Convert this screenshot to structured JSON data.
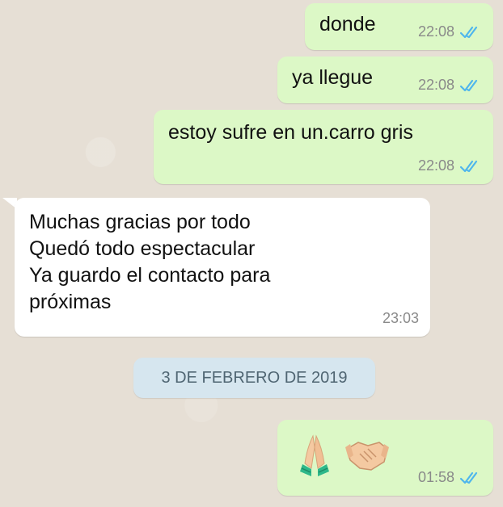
{
  "messages": [
    {
      "text": "donde",
      "time": "22:08",
      "read": true
    },
    {
      "text": "ya llegue",
      "time": "22:08",
      "read": true
    },
    {
      "text": "estoy sufre en un.carro gris",
      "time": "22:08",
      "read": true
    },
    {
      "text": "Muchas gracias por todo\nQuedó todo espectacular\nYa guardo el contacto para\npróximas",
      "time": "23:03"
    },
    {
      "emojis": [
        "folded-hands",
        "handshake"
      ],
      "time": "01:58",
      "read": true
    }
  ],
  "date_separator": "3 DE FEBRERO DE 2019",
  "colors": {
    "outgoing": "#dcf8c6",
    "incoming": "#ffffff",
    "tick_read": "#4fb6ec",
    "date_chip": "#d6e6ef"
  }
}
